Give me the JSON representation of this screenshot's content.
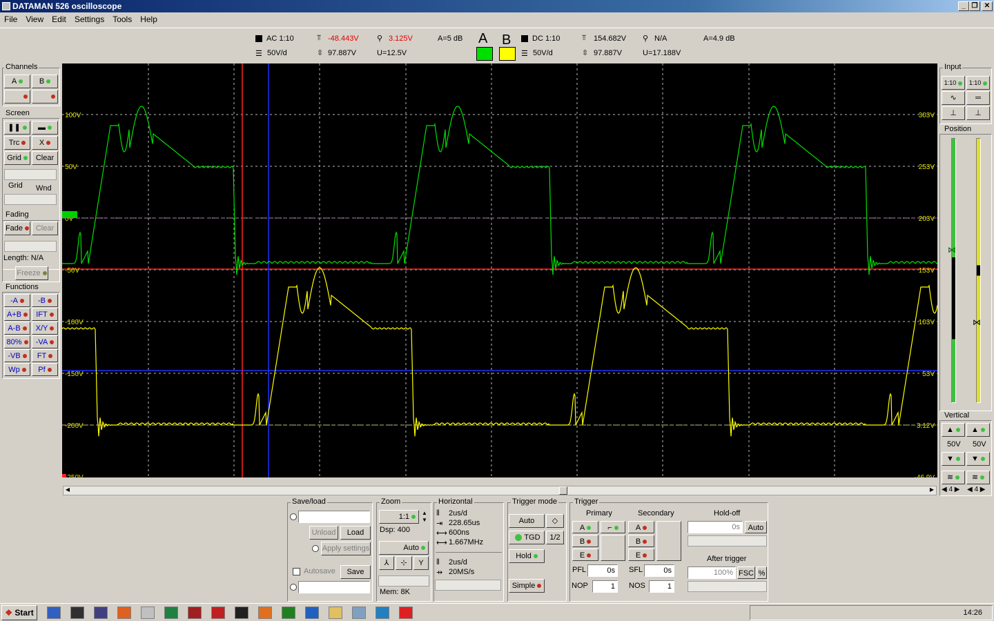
{
  "window": {
    "title": "DATAMAN 526 oscilloscope"
  },
  "menu": [
    "File",
    "View",
    "Edit",
    "Settings",
    "Tools",
    "Help"
  ],
  "chA": {
    "coupling": "AC 1:10",
    "vdiv": "50V/d",
    "trig_level": "-48.443V",
    "delta_v": "97.887V",
    "cursor": "3.125V",
    "u": "U=12.5V",
    "gain": "A=5 dB",
    "letter": "A",
    "color": "#00e000"
  },
  "chB": {
    "coupling": "DC 1:10",
    "vdiv": "50V/d",
    "trig_level": "154.682V",
    "delta_v": "97.887V",
    "cursor": "N/A",
    "u": "U=17.188V",
    "gain": "A=4.9 dB",
    "letter": "B",
    "color": "#ffff00"
  },
  "left": {
    "channels_title": "Channels",
    "ch_a": "A",
    "ch_b": "B",
    "screen_title": "Screen",
    "trc": "Trc",
    "x": "X",
    "grid": "Grid",
    "clear": "Clear",
    "grid_lbl": "Grid",
    "wnd_lbl": "Wnd",
    "fading_title": "Fading",
    "fade": "Fade",
    "fade_clear": "Clear",
    "length": "Length: N/A",
    "freeze": "Freeze",
    "functions_title": "Functions",
    "functions": [
      [
        "-A",
        "-B"
      ],
      [
        "A+B",
        "IFT"
      ],
      [
        "A-B",
        "X/Y"
      ],
      [
        "80%",
        "-VA"
      ],
      [
        "-VB",
        "FT"
      ],
      [
        "Wp",
        "Pf"
      ]
    ]
  },
  "scope": {
    "left_labels": [
      "100V",
      "50V",
      "0V",
      "-50V",
      "-100V",
      "-150V",
      "-200V",
      "-250V"
    ],
    "right_labels": [
      "303V",
      "253V",
      "203V",
      "153V",
      "103V",
      "53V",
      "3.12V",
      "-46.9V"
    ]
  },
  "right": {
    "input_title": "Input",
    "in_a": "1:10",
    "in_b": "1:10",
    "position_title": "Position",
    "vertical_title": "Vertical",
    "v_a": "50V",
    "v_b": "50V",
    "n_a": "4",
    "n_b": "4"
  },
  "bottom": {
    "saveload_title": "Save/load",
    "unload": "Unload",
    "load": "Load",
    "apply": "Apply settings",
    "autosave": "Autosave",
    "save": "Save",
    "zoom_title": "Zoom",
    "zoom_val": "1:1",
    "dsp": "Dsp:  400",
    "auto": "Auto",
    "mem": "Mem: 8K",
    "horiz_title": "Horizontal",
    "h1": "2us/d",
    "h2": "228.65us",
    "h3": "600ns",
    "h4": "1.667MHz",
    "h5": "2us/d",
    "h6": "20MS/s",
    "trigmode_title": "Trigger mode",
    "tm_auto": "Auto",
    "tm_tgd": "TGD",
    "tm_half": "1/2",
    "tm_hold": "Hold",
    "tm_simple": "Simple",
    "trigger_title": "Trigger",
    "primary": "Primary",
    "secondary": "Secondary",
    "holdoff": "Hold-off",
    "holdoff_val": "0s",
    "holdoff_auto": "Auto",
    "after": "After trigger",
    "after_val": "100%",
    "fsc": "FSC",
    "pct": "%",
    "ta": "A",
    "tb": "B",
    "te": "E",
    "pfl": "PFL",
    "pfl_val": "0s",
    "sfl": "SFL",
    "sfl_val": "0s",
    "nop": "NOP",
    "nop_val": "1",
    "nos": "NOS",
    "nos_val": "1"
  },
  "taskbar": {
    "start": "Start",
    "clock": "14:26"
  }
}
